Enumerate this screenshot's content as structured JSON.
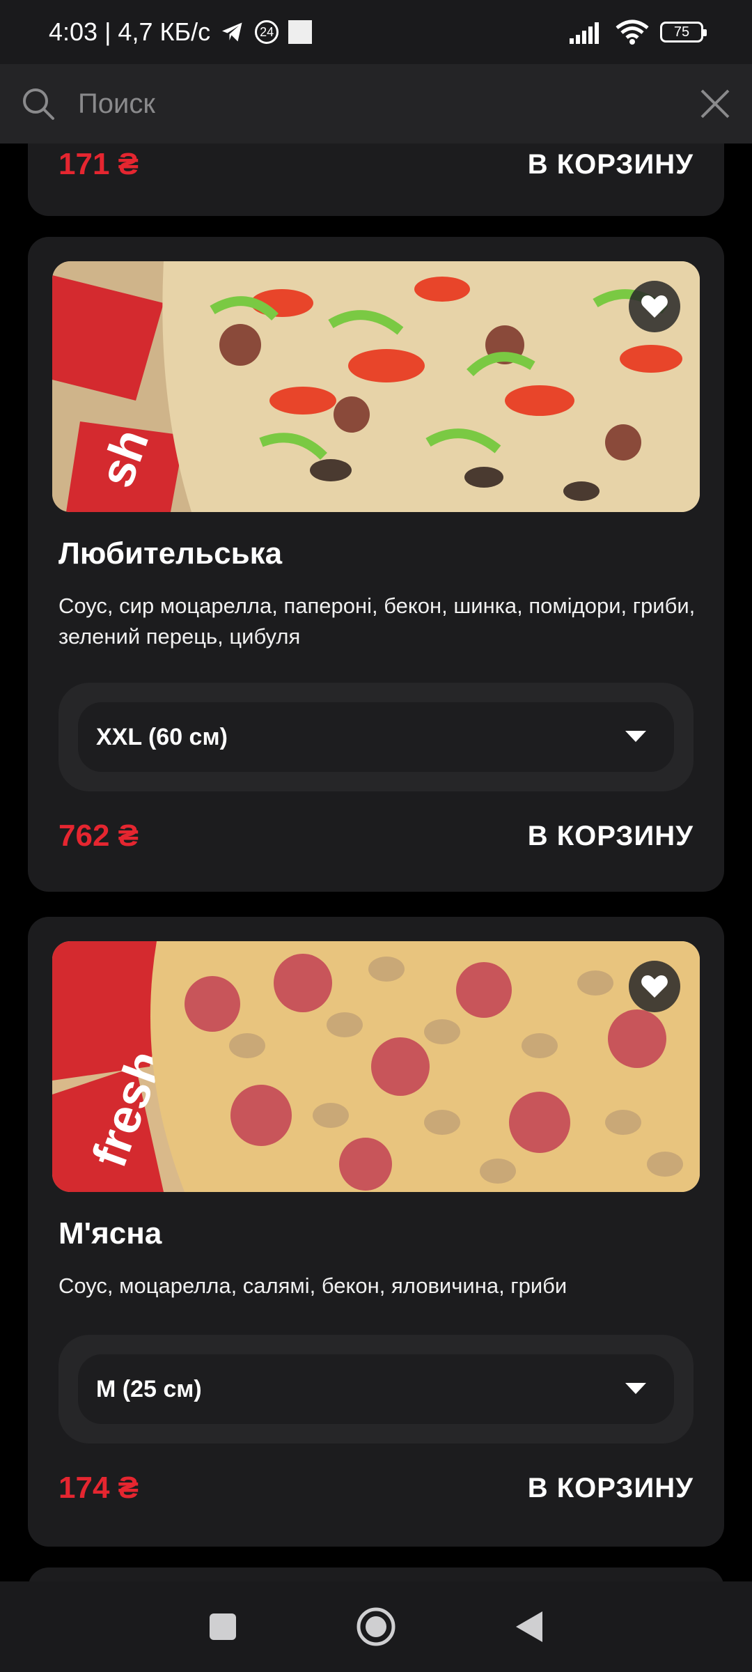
{
  "status_bar": {
    "time_speed": "4:03 | 4,7 КБ/с",
    "notif_badge": "24",
    "battery": "75",
    "icons": [
      "telegram-icon",
      "notification-badge-icon",
      "app-icon",
      "signal-icon",
      "wifi-icon",
      "battery-icon"
    ]
  },
  "search": {
    "placeholder": "Поиск",
    "value": ""
  },
  "partial_top_card": {
    "price": "171 ₴",
    "cart_label": "В КОРЗИНУ"
  },
  "products": [
    {
      "title": "Любительська",
      "description": "Соус, сир моцарелла, папероні, бекон, шинка, помідори, гриби, зелений перець, цибуля",
      "size": "XXL (60 см)",
      "price": "762 ₴",
      "cart_label": "В КОРЗИНУ"
    },
    {
      "title": "М'ясна",
      "description": "Соус, моцарелла, салямі, бекон, яловичина, гриби",
      "size": "M (25 см)",
      "price": "174 ₴",
      "cart_label": "В КОРЗИНУ"
    }
  ],
  "colors": {
    "price": "#e52630",
    "card": "#1c1c1e",
    "background": "#000000"
  },
  "nav_bar": {
    "icons": [
      "recent-apps-icon",
      "home-icon",
      "back-icon"
    ]
  }
}
